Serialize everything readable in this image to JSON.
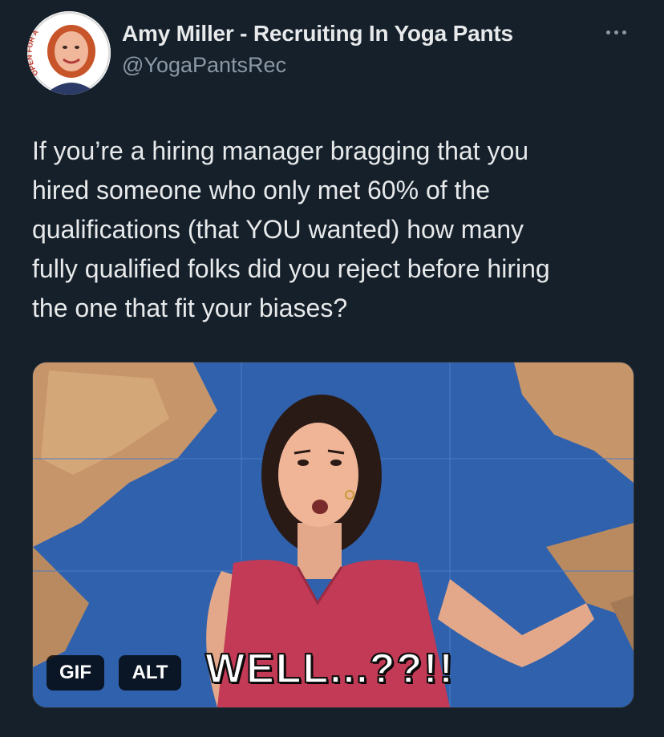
{
  "author": {
    "display_name": "Amy Miller - Recruiting In Yoga Pants",
    "handle": "@YogaPantsRec",
    "avatar_ring_text": "OPEN FOR ARGUING"
  },
  "tweet": {
    "text": "If you’re a hiring manager bragging that you\nhired someone who only met 60% of the\nqualifications (that YOU wanted) how many\nfully qualified folks did you reject before hiring\nthe one that fit your biases?"
  },
  "media": {
    "type": "gif",
    "caption": "WELL...??!!",
    "gif_badge": "GIF",
    "alt_badge": "ALT"
  },
  "icons": {
    "more": "more-horizontal-icon"
  },
  "colors": {
    "background": "#15202b",
    "primary_text": "#e7e9ea",
    "secondary_text": "#8b98a5"
  }
}
